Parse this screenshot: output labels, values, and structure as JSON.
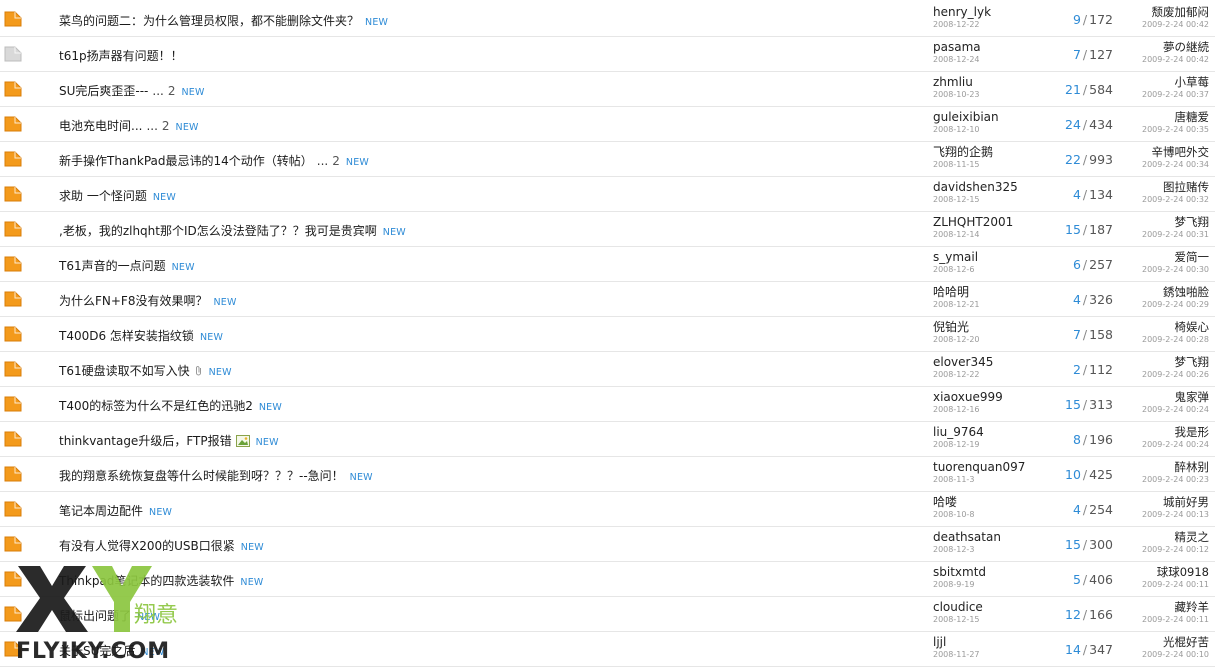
{
  "threads": [
    {
      "title": "菜鸟的问题二：为什么管理员权限，都不能删除文件夹？",
      "pages": "",
      "icon": "orange",
      "attach": "",
      "new": "NEW",
      "author": "henry_lyk",
      "date": "2008-12-22",
      "replies": "9",
      "views": "172",
      "last_user": "颓废加郁闷",
      "last_time": "2009-2-24 00:42"
    },
    {
      "title": "t61p扬声器有问题！！",
      "pages": "",
      "icon": "gray",
      "attach": "",
      "new": "",
      "author": "pasama",
      "date": "2008-12-24",
      "replies": "7",
      "views": "127",
      "last_user": "夢の継続",
      "last_time": "2009-2-24 00:42"
    },
    {
      "title": "SU完后爽歪歪---",
      "pages": "2",
      "icon": "orange",
      "attach": "",
      "new": "NEW",
      "author": "zhmliu",
      "date": "2008-10-23",
      "replies": "21",
      "views": "584",
      "last_user": "小草莓",
      "last_time": "2009-2-24 00:37"
    },
    {
      "title": "电池充电时间...",
      "pages": "2",
      "icon": "orange",
      "attach": "",
      "new": "NEW",
      "author": "guleixibian",
      "date": "2008-12-10",
      "replies": "24",
      "views": "434",
      "last_user": "唐糖爱",
      "last_time": "2009-2-24 00:35"
    },
    {
      "title": "新手操作ThankPad最忌讳的14个动作（转帖）",
      "pages": "2",
      "icon": "orange",
      "attach": "",
      "new": "NEW",
      "author": "飞翔的企鹅",
      "date": "2008-11-15",
      "replies": "22",
      "views": "993",
      "last_user": "辛博吧外交",
      "last_time": "2009-2-24 00:34"
    },
    {
      "title": "求助 一个怪问题",
      "pages": "",
      "icon": "orange",
      "attach": "",
      "new": "NEW",
      "author": "davidshen325",
      "date": "2008-12-15",
      "replies": "4",
      "views": "134",
      "last_user": "图拉赌传",
      "last_time": "2009-2-24 00:32"
    },
    {
      "title": ",老板，我的zlhqht那个ID怎么没法登陆了？？我可是贵宾啊",
      "pages": "",
      "icon": "orange",
      "attach": "",
      "new": "NEW",
      "author": "ZLHQHT2001",
      "date": "2008-12-14",
      "replies": "15",
      "views": "187",
      "last_user": "梦飞翔",
      "last_time": "2009-2-24 00:31"
    },
    {
      "title": "T61声音的一点问题",
      "pages": "",
      "icon": "orange",
      "attach": "",
      "new": "NEW",
      "author": "s_ymail",
      "date": "2008-12-6",
      "replies": "6",
      "views": "257",
      "last_user": "爱简一",
      "last_time": "2009-2-24 00:30"
    },
    {
      "title": "为什么FN+F8没有效果啊？",
      "pages": "",
      "icon": "orange",
      "attach": "",
      "new": "NEW",
      "author": "哈哈明",
      "date": "2008-12-21",
      "replies": "4",
      "views": "326",
      "last_user": "銹蚀啪脸",
      "last_time": "2009-2-24 00:29"
    },
    {
      "title": "T400D6 怎样安装指纹锁",
      "pages": "",
      "icon": "orange",
      "attach": "",
      "new": "NEW",
      "author": "倪铂光",
      "date": "2008-12-20",
      "replies": "7",
      "views": "158",
      "last_user": "椅娱心",
      "last_time": "2009-2-24 00:28"
    },
    {
      "title": "T61硬盘读取不如写入快",
      "pages": "",
      "icon": "orange",
      "attach": "clip",
      "new": "NEW",
      "author": "elover345",
      "date": "2008-12-22",
      "replies": "2",
      "views": "112",
      "last_user": "梦飞翔",
      "last_time": "2009-2-24 00:26"
    },
    {
      "title": "T400的标签为什么不是红色的迅驰2",
      "pages": "",
      "icon": "orange",
      "attach": "",
      "new": "NEW",
      "author": "xiaoxue999",
      "date": "2008-12-16",
      "replies": "15",
      "views": "313",
      "last_user": "鬼家弹",
      "last_time": "2009-2-24 00:24"
    },
    {
      "title": "thinkvantage升级后，FTP报错",
      "pages": "",
      "icon": "orange",
      "attach": "image",
      "new": "NEW",
      "author": "liu_9764",
      "date": "2008-12-19",
      "replies": "8",
      "views": "196",
      "last_user": "我是形",
      "last_time": "2009-2-24 00:24"
    },
    {
      "title": "我的翔意系统恢复盘等什么时候能到呀？？？--急问！",
      "pages": "",
      "icon": "orange",
      "attach": "",
      "new": "NEW",
      "author": "tuorenquan097",
      "date": "2008-11-3",
      "replies": "10",
      "views": "425",
      "last_user": "醉林别",
      "last_time": "2009-2-24 00:23"
    },
    {
      "title": "笔记本周边配件",
      "pages": "",
      "icon": "orange",
      "attach": "",
      "new": "NEW",
      "author": "哈喽",
      "date": "2008-10-8",
      "replies": "4",
      "views": "254",
      "last_user": "城前好男",
      "last_time": "2009-2-24 00:13"
    },
    {
      "title": "有没有人觉得X200的USB口很紧",
      "pages": "",
      "icon": "orange",
      "attach": "",
      "new": "NEW",
      "author": "deathsatan",
      "date": "2008-12-3",
      "replies": "15",
      "views": "300",
      "last_user": "精灵之",
      "last_time": "2009-2-24 00:12"
    },
    {
      "title": "Thinkpad笔记本的四款选装软件",
      "pages": "",
      "icon": "orange",
      "attach": "",
      "new": "NEW",
      "author": "sbitxmtd",
      "date": "2008-9-19",
      "replies": "5",
      "views": "406",
      "last_user": "球球0918",
      "last_time": "2009-2-24 00:11"
    },
    {
      "title": "鼠标出问题了",
      "pages": "",
      "icon": "orange",
      "attach": "",
      "new": "NEW",
      "author": "cloudice",
      "date": "2008-12-15",
      "replies": "12",
      "views": "166",
      "last_user": "藏羚羊",
      "last_time": "2009-2-24 00:11"
    },
    {
      "title": "关于SU完之后",
      "pages": "",
      "icon": "orange",
      "attach": "",
      "new": "NEW",
      "author": "ljjl",
      "date": "2008-11-27",
      "replies": "14",
      "views": "347",
      "last_user": "光棍好苦",
      "last_time": "2009-2-24 00:10"
    }
  ],
  "watermark": {
    "brand": "FLYIKY.COM",
    "cn": "翔意",
    "color_dark": "#1a1a1a",
    "color_green": "#8cc63f"
  },
  "colors": {
    "folder_orange": "#f39a1c",
    "folder_gray": "#d9d9d9",
    "link_blue": "#2e8bd6"
  }
}
